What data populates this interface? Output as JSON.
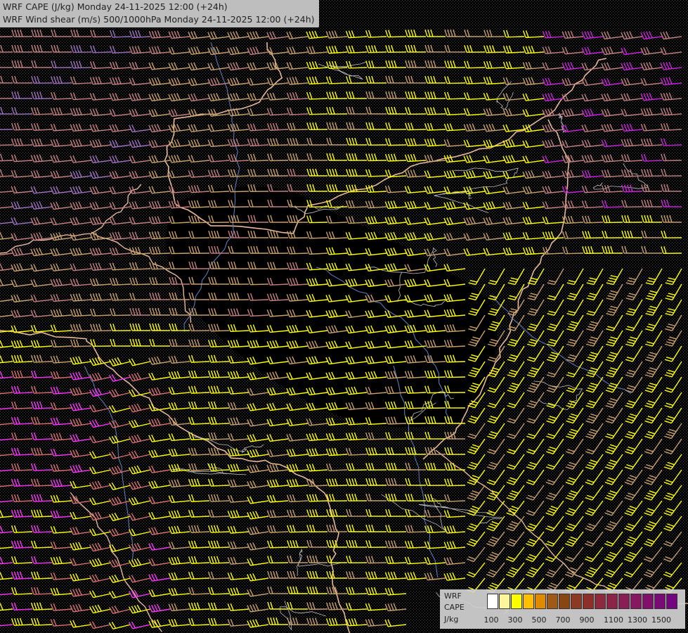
{
  "header": {
    "line1": "WRF CAPE (J/kg) Monday 24-11-2025 12:00 (+24h)",
    "line2": "WRF Wind shear (m/s) 500/1000hPa Monday 24-11-2025 12:00 (+24h)"
  },
  "legend": {
    "label_model": "WRF",
    "label_field": "CAPE",
    "label_unit": "J/kg",
    "colors": [
      "#ffffff",
      "#fff59a",
      "#ffff00",
      "#ffbf00",
      "#e08a00",
      "#a05a16",
      "#8b4513",
      "#8e3a22",
      "#8f2f2a",
      "#8e2a3c",
      "#8c2448",
      "#8a1d55",
      "#861760",
      "#80106b",
      "#7a0a75",
      "#740480"
    ],
    "tick_labels": [
      "100",
      "300",
      "500",
      "700",
      "900",
      "1100",
      "1300",
      "1500"
    ]
  },
  "map": {
    "barb_colors": [
      "#ffff00",
      "#e8d23a",
      "#c9a06a",
      "#c48080",
      "#d97070",
      "#e05aa0",
      "#cc22dd",
      "#ff33ff",
      "#a070c0"
    ],
    "border_color": "#e8b898",
    "river_color": "#5a7ab8",
    "region_lines_color": "#c0c0c0"
  }
}
